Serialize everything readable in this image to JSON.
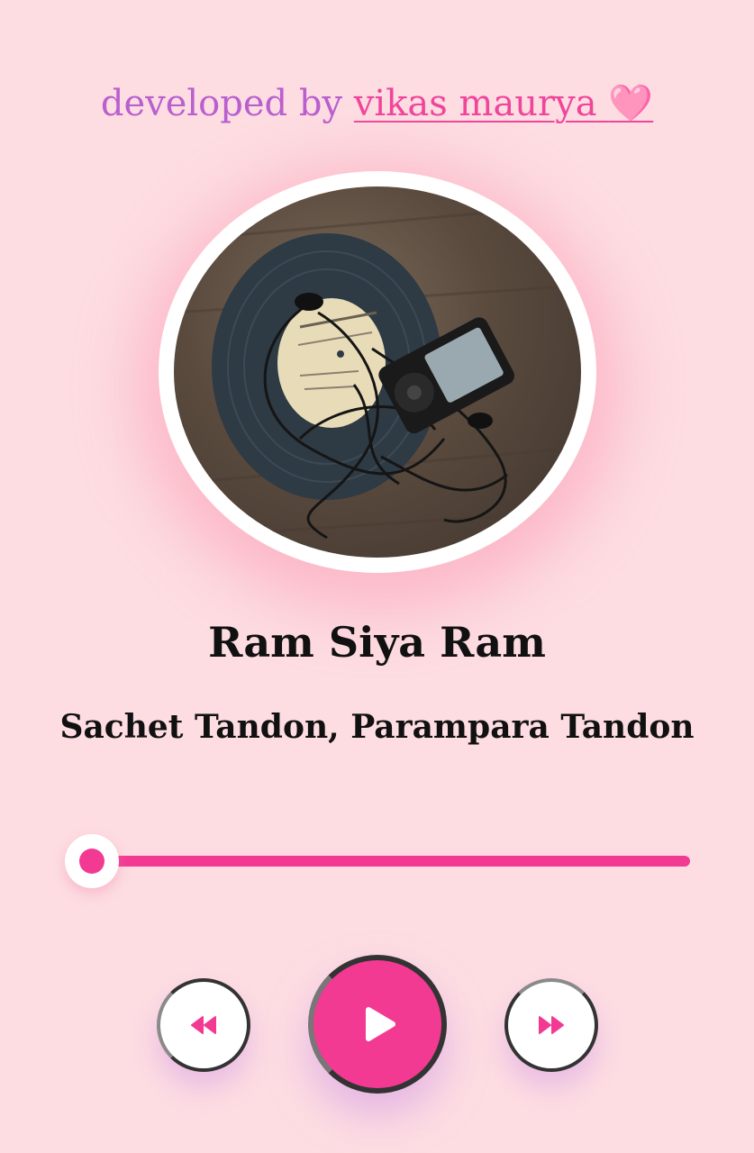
{
  "credit": {
    "prefix": "developed by",
    "author": "vikas maurya",
    "heart": "🩷"
  },
  "track": {
    "title": "Ram Siya Ram",
    "artist": "Sachet Tandon, Parampara Tandon",
    "cover_alt": "vinyl record with music player"
  },
  "progress": {
    "fraction": 0.0
  },
  "controls": {
    "prev_icon": "rewind-icon",
    "play_icon": "play-icon",
    "next_icon": "fast-forward-icon"
  },
  "colors": {
    "background": "#fddde2",
    "accent": "#f33a93",
    "credit_text": "#b95fcf",
    "author_link": "#f0459b"
  }
}
